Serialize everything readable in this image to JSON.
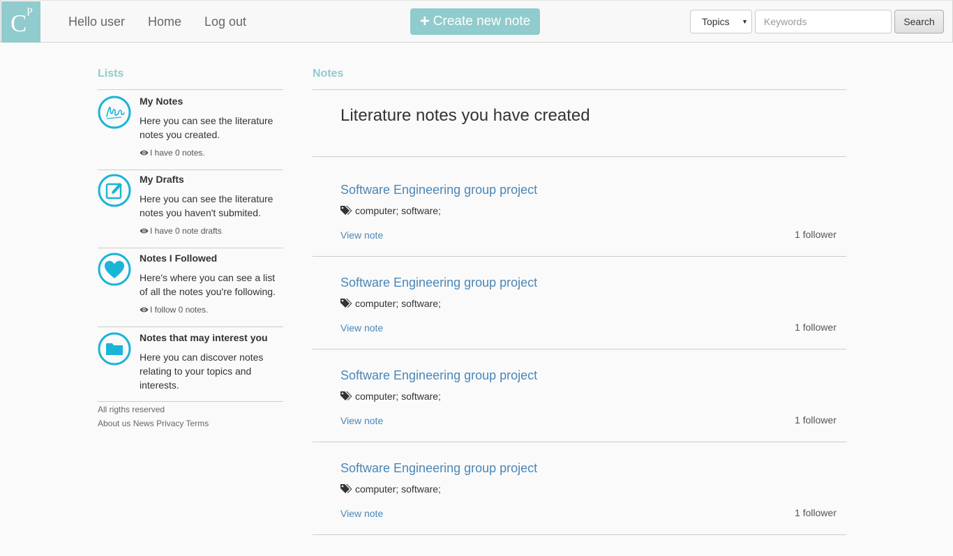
{
  "colors": {
    "accent": "#90cbcd",
    "icon": "#1ab4d6",
    "link": "#4a86b8"
  },
  "navbar": {
    "logo_c": "C",
    "logo_p": "P",
    "hello": "Hello user",
    "home": "Home",
    "logout": "Log out",
    "create_label": "Create new note",
    "topics_label": "Topics",
    "keywords_placeholder": "Keywords",
    "search_label": "Search"
  },
  "sidebar": {
    "heading": "Lists",
    "items": [
      {
        "icon": "note-signature-icon",
        "title": "My Notes",
        "desc": "Here you can see the literature notes you created.",
        "stat": "I have 0 notes."
      },
      {
        "icon": "edit-pencil-icon",
        "title": "My Drafts",
        "desc": "Here you can see the literature notes you haven't submited.",
        "stat": "I have 0 note drafts"
      },
      {
        "icon": "heart-icon",
        "title": "Notes I Followed",
        "desc": "Here's where you can see a list of all the notes you're following.",
        "stat": "I follow 0 notes."
      },
      {
        "icon": "folder-icon",
        "title": "Notes that may interest you",
        "desc": "Here you can discover notes relating to your topics and interests.",
        "stat": ""
      }
    ],
    "footer": {
      "rights": "All rigths reserved",
      "links": [
        "About us",
        "News",
        "Privacy",
        "Terms"
      ]
    }
  },
  "main": {
    "heading": "Notes",
    "title": "Literature notes you have created",
    "notes": [
      {
        "title": "Software Engineering group project",
        "tags": "computer; software;",
        "view": "View note",
        "followers": "1 follower"
      },
      {
        "title": "Software Engineering group project",
        "tags": "computer; software;",
        "view": "View note",
        "followers": "1 follower"
      },
      {
        "title": "Software Engineering group project",
        "tags": "computer; software;",
        "view": "View note",
        "followers": "1 follower"
      },
      {
        "title": "Software Engineering group project",
        "tags": "computer; software;",
        "view": "View note",
        "followers": "1 follower"
      }
    ]
  }
}
